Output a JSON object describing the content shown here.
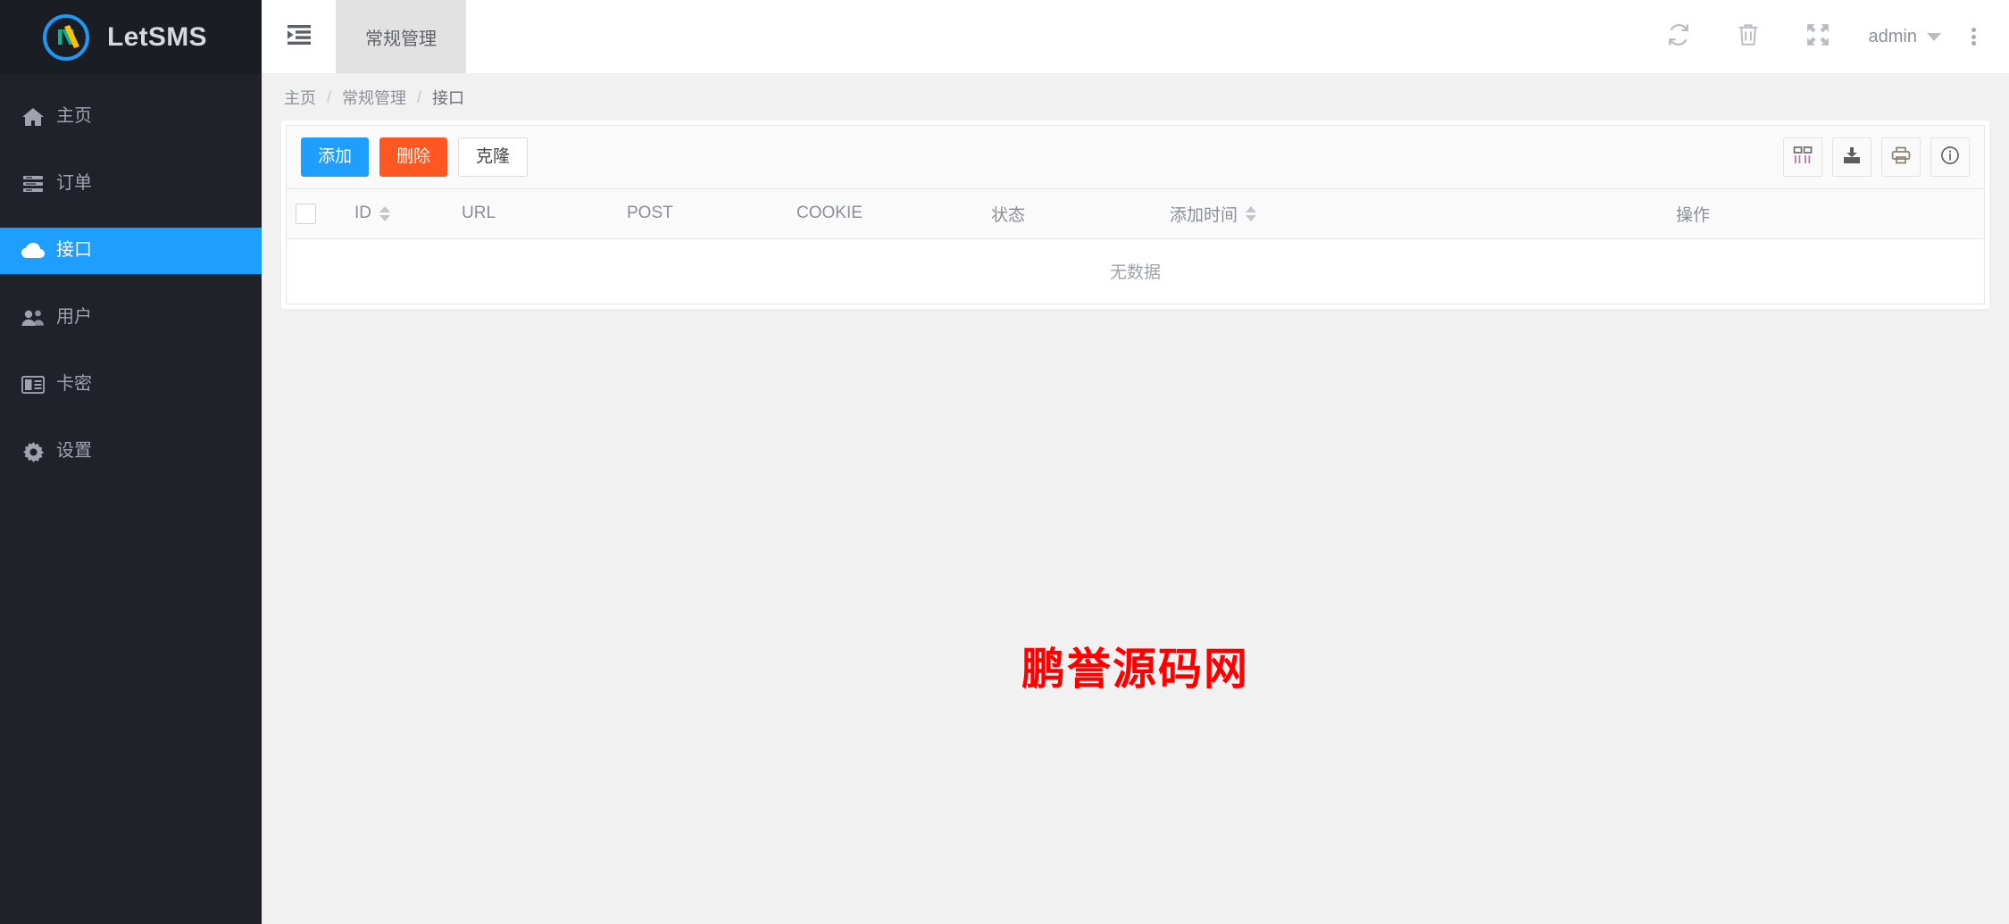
{
  "brand": {
    "name": "LetSMS",
    "logo_icon": "letsms-logo-icon",
    "ring_color": "#2196f3",
    "glyph_colors": [
      "#00b894",
      "#ffc107"
    ]
  },
  "sidebar": {
    "items": [
      {
        "label": "主页",
        "icon": "home-icon",
        "active": false
      },
      {
        "label": "订单",
        "icon": "list-icon",
        "active": false
      },
      {
        "label": "接口",
        "icon": "cloud-icon",
        "active": true
      },
      {
        "label": "用户",
        "icon": "users-icon",
        "active": false
      },
      {
        "label": "卡密",
        "icon": "id-card-icon",
        "active": false
      },
      {
        "label": "设置",
        "icon": "gear-icon",
        "active": false
      }
    ],
    "active_color": "#1e9fff",
    "bg_color": "#20222a"
  },
  "header": {
    "collapse_icon": "indent-sidebar-icon",
    "tabs": [
      {
        "label": "常规管理",
        "active": true
      }
    ],
    "icons": [
      {
        "name": "refresh-icon"
      },
      {
        "name": "trash-icon"
      },
      {
        "name": "fullscreen-icon"
      }
    ],
    "user": "admin",
    "more_icon": "more-vertical-icon"
  },
  "breadcrumb": {
    "items": [
      "主页",
      "常规管理",
      "接口"
    ],
    "separator": "/"
  },
  "toolbar": {
    "add_label": "添加",
    "delete_label": "删除",
    "clone_label": "克隆",
    "add_color": "#1e9fff",
    "delete_color": "#ff5722",
    "icons": [
      {
        "name": "columns-icon"
      },
      {
        "name": "export-icon"
      },
      {
        "name": "print-icon"
      },
      {
        "name": "info-icon"
      }
    ]
  },
  "table": {
    "select_all_checkbox": "",
    "columns": [
      {
        "label": "ID",
        "sortable": true
      },
      {
        "label": "URL",
        "sortable": false
      },
      {
        "label": "POST",
        "sortable": false
      },
      {
        "label": "COOKIE",
        "sortable": false
      },
      {
        "label": "状态",
        "sortable": false
      },
      {
        "label": "添加时间",
        "sortable": true
      },
      {
        "label": "操作",
        "sortable": false
      }
    ],
    "rows": [],
    "empty_text": "无数据"
  },
  "watermark": {
    "text": "鹏誉源码网",
    "color": "#ff0000"
  }
}
